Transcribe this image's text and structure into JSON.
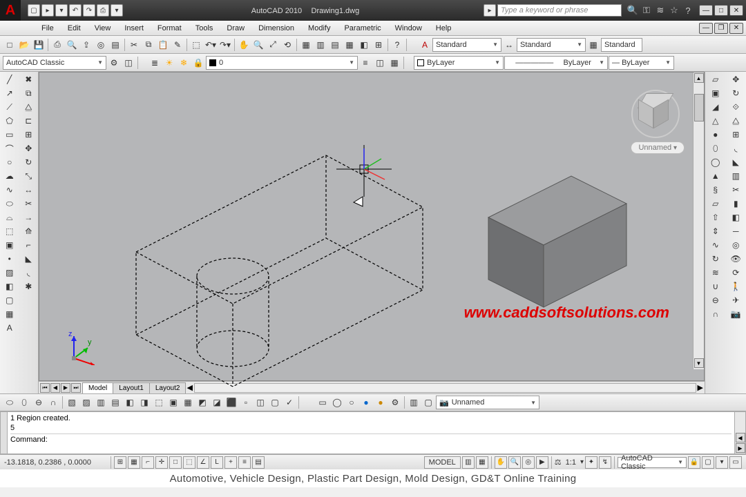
{
  "title": {
    "app": "AutoCAD 2010",
    "doc": "Drawing1.dwg"
  },
  "search": {
    "placeholder": "Type a keyword or phrase"
  },
  "menu": [
    "File",
    "Edit",
    "View",
    "Insert",
    "Format",
    "Tools",
    "Draw",
    "Dimension",
    "Modify",
    "Parametric",
    "Window",
    "Help"
  ],
  "workspace": "AutoCAD Classic",
  "layer": {
    "value": "0"
  },
  "styles": {
    "text": "Standard",
    "dim": "Standard",
    "table": "Standard"
  },
  "bylayer": {
    "color": "ByLayer",
    "ltype": "ByLayer",
    "lw": "ByLayer"
  },
  "view_label": "Unnamed",
  "tabs": [
    "Model",
    "Layout1",
    "Layout2"
  ],
  "camera_combo": "Unnamed",
  "cmd": {
    "line1": "1 Region created.",
    "line2": "5",
    "prompt": "Command:"
  },
  "status": {
    "coords": "-13.1818, 0.2386 , 0.0000",
    "space": "MODEL",
    "scale": "1:1",
    "ws": "AutoCAD Classic"
  },
  "url": "www.caddsoftsolutions.com",
  "footer": "Automotive, Vehicle Design, Plastic Part Design, Mold Design, GD&T Online Training"
}
